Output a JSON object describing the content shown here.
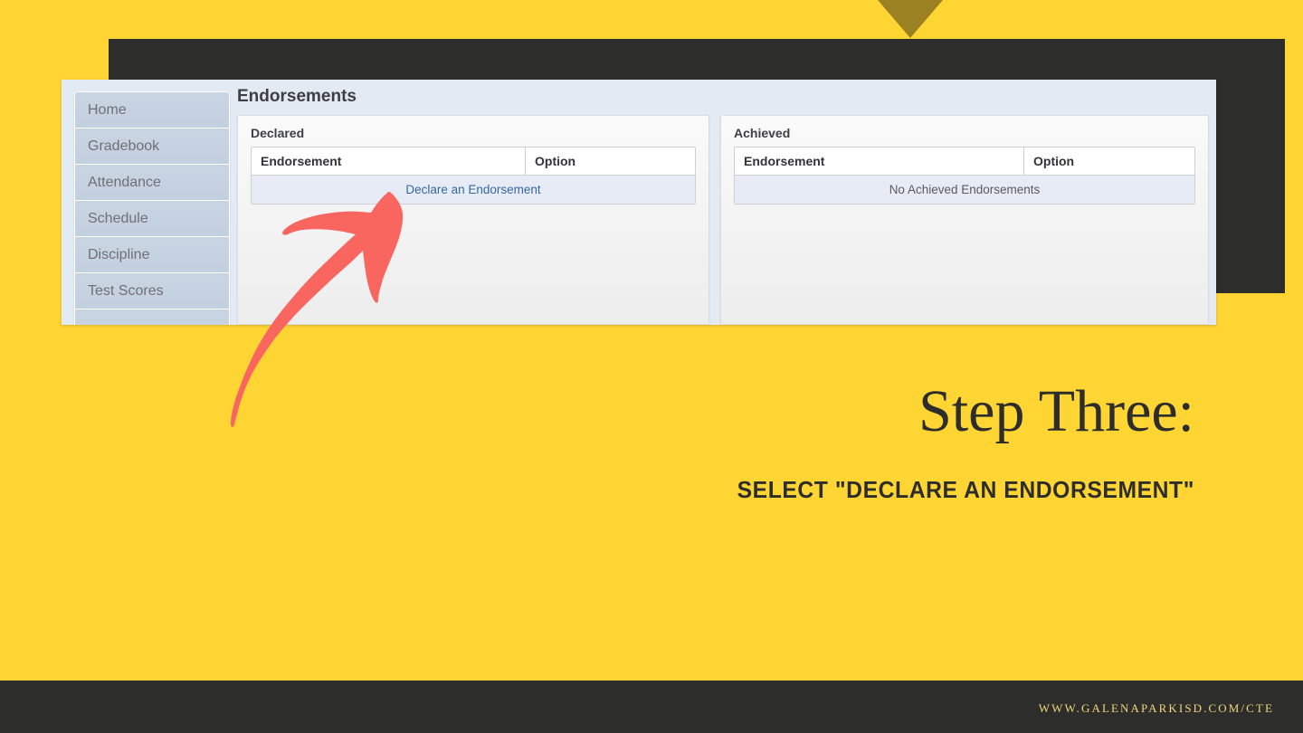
{
  "slide": {
    "background_color": "#FFD534",
    "dark_color": "#2D2D2B",
    "accent_gold": "#9B8122",
    "arrow_color": "#F9655F",
    "headline": "Step Three:",
    "subhead": "SELECT \"DECLARE AN ENDORSEMENT\"",
    "footer_url": "WWW.GALENAPARKISD.COM/CTE",
    "footer_color": "#F2D67C"
  },
  "screenshot": {
    "sidebar": {
      "items": [
        {
          "label": "Home"
        },
        {
          "label": "Gradebook"
        },
        {
          "label": "Attendance"
        },
        {
          "label": "Schedule"
        },
        {
          "label": "Discipline"
        },
        {
          "label": "Test Scores"
        },
        {
          "label": ""
        }
      ]
    },
    "page_title": "Endorsements",
    "panels": [
      {
        "label": "Declared",
        "columns": [
          "Endorsement",
          "Option"
        ],
        "row_text": "Declare an Endorsement",
        "row_is_link": true
      },
      {
        "label": "Achieved",
        "columns": [
          "Endorsement",
          "Option"
        ],
        "row_text": "No Achieved Endorsements",
        "row_is_link": false
      }
    ]
  }
}
